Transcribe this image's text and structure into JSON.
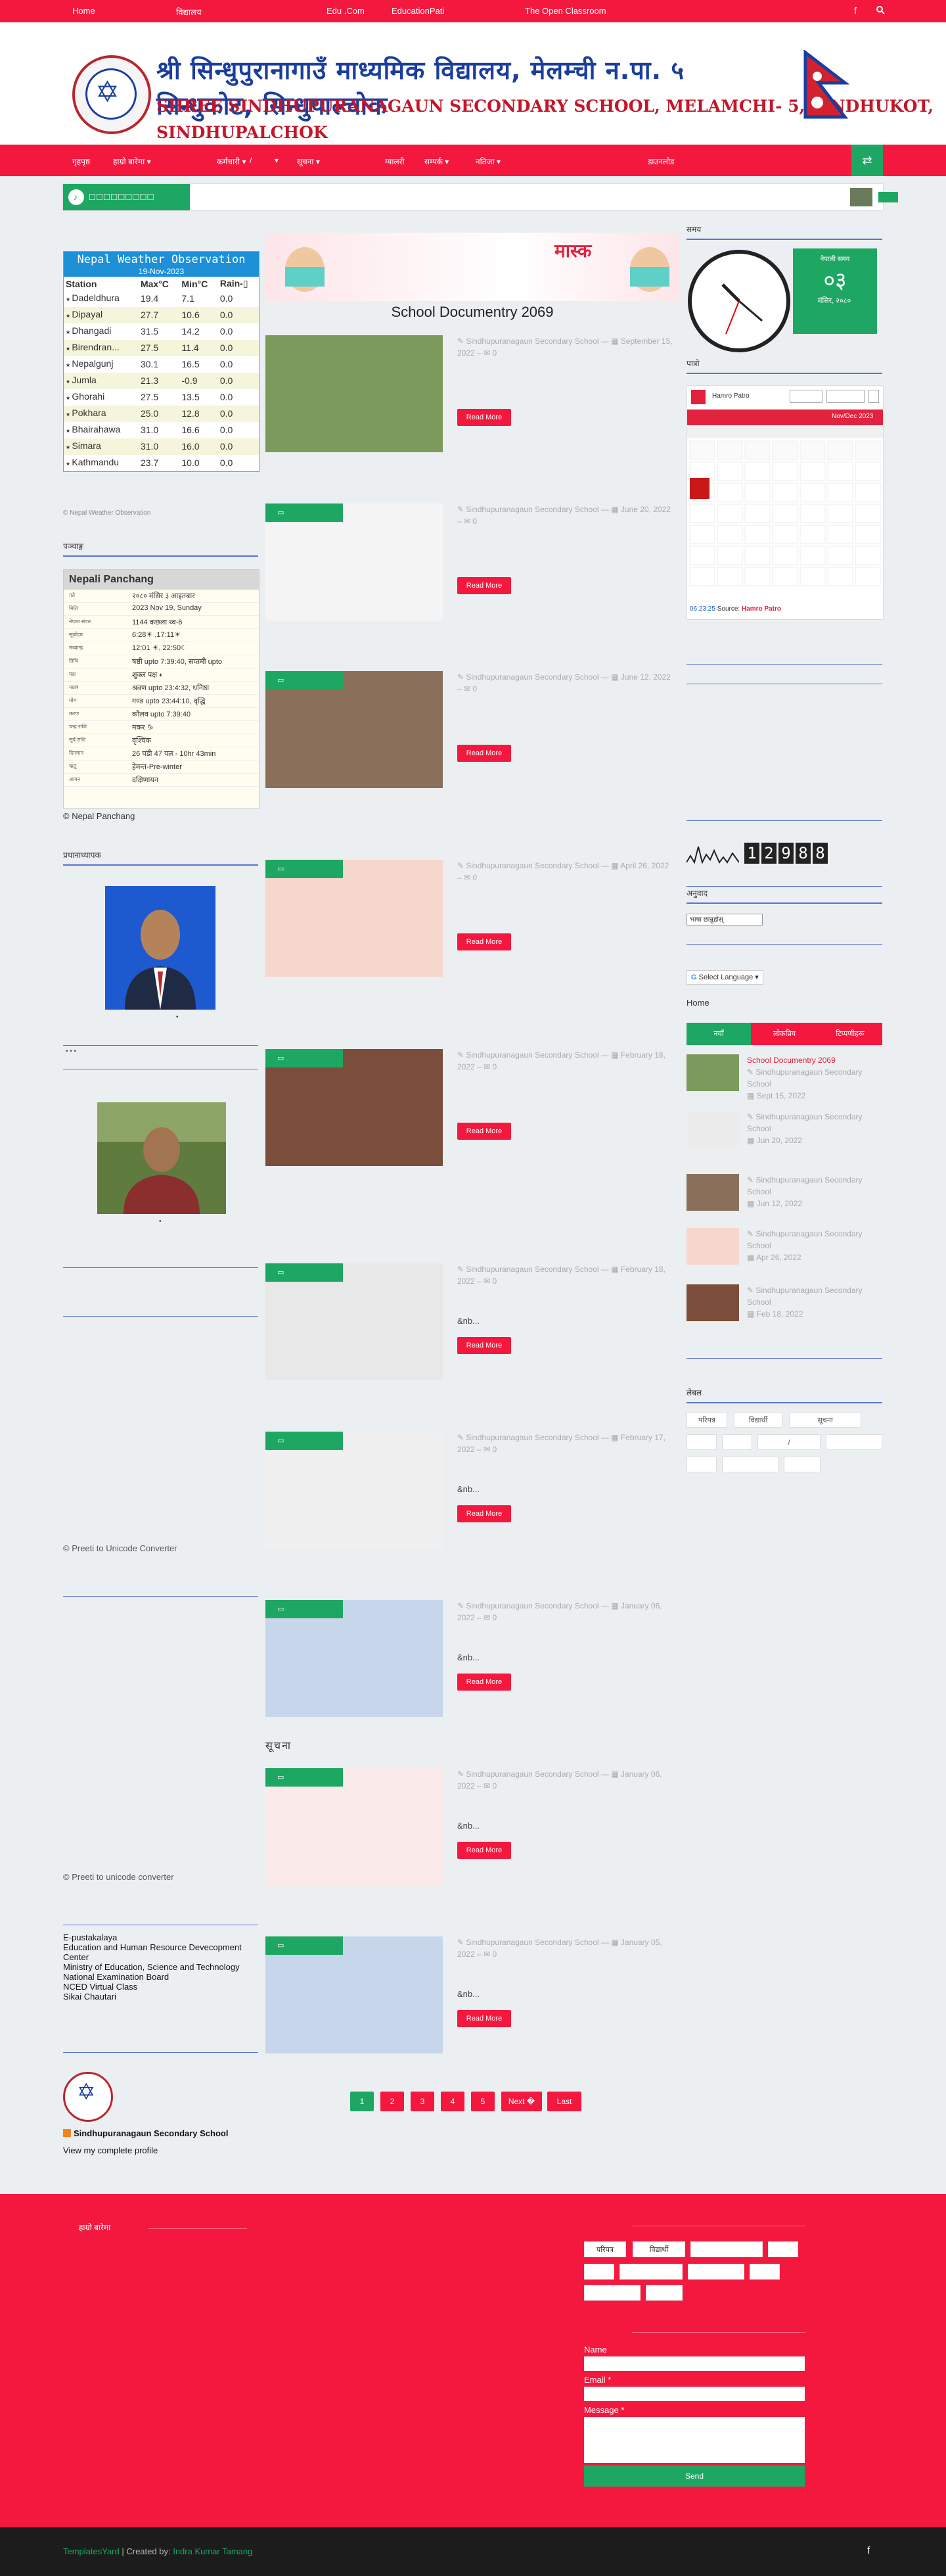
{
  "topbar": {
    "links": [
      "Home",
      "विद्यालय",
      "Edu .Com",
      "EducationPati",
      "The Open Classroom"
    ],
    "facebook_icon": "facebook-icon",
    "search_icon": "search-icon"
  },
  "header": {
    "title_ne": "श्री सिन्धुपुरानागाउँ माध्यमिक विद्यालय, मेलम्ची न.पा. ५ सिन्धुकोट, सिन्धुपाल्चोक",
    "title_en": "SHREE SINDHUPURANAGAUN SECONDARY SCHOOL, MELAMCHI- 5, SINDHUKOT, SINDHUPALCHOK"
  },
  "nav": {
    "items": [
      "गृहपृष्ठ",
      "हाम्रो बारेमा ▾",
      "कर्मचारी ▾",
      "/",
      "▾",
      "सूचना ▾",
      "ग्यालरी",
      "सम्पर्क ▾",
      "नतिजा ▾",
      "डाउनलोड"
    ],
    "shuffle_icon": "shuffle-icon"
  },
  "ticker": {
    "label": "□□□□□□□□□",
    "music_icon": "music-icon"
  },
  "weather": {
    "title": "Nepal Weather Observation",
    "date": "19-Nov-2023",
    "headers": [
      "Station",
      "Max°C",
      "Min°C",
      "Rain-▯"
    ],
    "rows": [
      [
        "Dadeldhura",
        "19.4",
        "7.1",
        "0.0"
      ],
      [
        "Dipayal",
        "27.7",
        "10.6",
        "0.0"
      ],
      [
        "Dhangadi",
        "31.5",
        "14.2",
        "0.0"
      ],
      [
        "Birendran...",
        "27.5",
        "11.4",
        "0.0"
      ],
      [
        "Nepalgunj",
        "30.1",
        "16.5",
        "0.0"
      ],
      [
        "Jumla",
        "21.3",
        "-0.9",
        "0.0"
      ],
      [
        "Ghorahi",
        "27.5",
        "13.5",
        "0.0"
      ],
      [
        "Pokhara",
        "25.0",
        "12.8",
        "0.0"
      ],
      [
        "Bhairahawa",
        "31.0",
        "16.6",
        "0.0"
      ],
      [
        "Simara",
        "31.0",
        "16.0",
        "0.0"
      ],
      [
        "Kathmandu",
        "23.7",
        "10.0",
        "0.0"
      ]
    ],
    "credit": "© Nepal Weather Observation"
  },
  "panchang": {
    "section_title": "पञ्चाङ्ग",
    "title": "Nepali Panchang",
    "rows": [
      [
        "गते",
        "२०८० मंसिर ३ आइतबार"
      ],
      [
        "मिति",
        "2023 Nov 19, Sunday"
      ],
      [
        "नेपाल संवत",
        "1144 कछला थ्व-6"
      ],
      [
        "सूर्योदय",
        "6:28☀ ,17:11☀"
      ],
      [
        "मध्यान्ह",
        "12:01 ☀, 22:50☾"
      ],
      [
        "तिथि",
        "षष्ठी upto 7:39:40, सप्तमी upto"
      ],
      [
        "पक्ष",
        "शुक्ल पक्ष ◐"
      ],
      [
        "नक्षत्र",
        "श्रवण upto 23:4:32, धनिष्ठा"
      ],
      [
        "योग",
        "गण्ड upto 23:44:10, वृद्धि"
      ],
      [
        "करण",
        "कौलव upto 7:39:40"
      ],
      [
        "चन्द्र राशि",
        "मकर ♑"
      ],
      [
        "सूर्य राशि",
        "वृश्चिक"
      ],
      [
        "दिनमान",
        "26 घडी 47 पल - 10hr 43min"
      ],
      [
        "ऋतु",
        "हेमन्त-Pre-winter"
      ],
      [
        "आयन",
        "दक्षिणायन"
      ]
    ],
    "credit": "© Nepal Panchang"
  },
  "people": {
    "title1": "प्रधानाध्यापक",
    "title2": "",
    "caption1": "•",
    "caption2": "•"
  },
  "converters": {
    "c1": "© Preeti to Unicode Converter",
    "c2": "© Preeti to unicode converter"
  },
  "links_widget": {
    "items": [
      "E-pustakalaya",
      "Education and Human Resource Devecopment Center",
      "Ministry of Education, Science and Technology",
      "National Examination Board",
      "NCED Virtual Class",
      "Sikai Chautari"
    ]
  },
  "profile": {
    "name": "Sindhupuranagaun Secondary School",
    "link": "View my complete profile"
  },
  "main": {
    "heading": "School Documentry 2069",
    "banner_text": "मास्क",
    "section_label": "सूचना",
    "read_more": "Read More",
    "posts": [
      {
        "author": "Sindhupuranagaun Secondary School",
        "date": "September 15, 2022",
        "comments": "0",
        "excerpt": ""
      },
      {
        "author": "Sindhupuranagaun Secondary School",
        "date": "June 20, 2022",
        "comments": "0",
        "excerpt": ""
      },
      {
        "author": "Sindhupuranagaun Secondary School",
        "date": "June 12, 2022",
        "comments": "0",
        "excerpt": ""
      },
      {
        "author": "Sindhupuranagaun Secondary School",
        "date": "April 26, 2022",
        "comments": "0",
        "excerpt": ""
      },
      {
        "author": "Sindhupuranagaun Secondary School",
        "date": "February 18, 2022",
        "comments": "0",
        "excerpt": ""
      },
      {
        "author": "Sindhupuranagaun Secondary School",
        "date": "February 18, 2022",
        "comments": "0",
        "excerpt": "&nb..."
      },
      {
        "author": "Sindhupuranagaun Secondary School",
        "date": "February 17, 2022",
        "comments": "0",
        "excerpt": "&nb..."
      },
      {
        "author": "Sindhupuranagaun Secondary School",
        "date": "January 06, 2022",
        "comments": "0",
        "excerpt": "&nb..."
      },
      {
        "author": "Sindhupuranagaun Secondary School",
        "date": "January 06, 2022",
        "comments": "0",
        "excerpt": "&nb..."
      },
      {
        "author": "Sindhupuranagaun Secondary School",
        "date": "January 05, 2022",
        "comments": "0",
        "excerpt": "&nb..."
      }
    ],
    "pagination": [
      "1",
      "2",
      "3",
      "4",
      "5",
      "Next �",
      "Last"
    ]
  },
  "right": {
    "time_title": "समय",
    "clock_label": "नेपाली समय",
    "clock_date": "०३",
    "clock_sub": "मंसिर, २०८०",
    "calendar_title": "पात्रो",
    "calendar_brand": "Hamro Patro",
    "calendar_month": "Nov/Dec 2023",
    "calendar_time": "06:23:25",
    "calendar_source": "Source:",
    "calendar_source_name": "Hamro Patro",
    "counter_digits": [
      "1",
      "2",
      "9",
      "8",
      "8"
    ],
    "translate_title": "अनुवाद",
    "translate_select": "भाषा छान्नुहोस्",
    "select_language": "Select Language",
    "home": "Home",
    "tabs": [
      "नयाँ",
      "लोकप्रिय",
      "टिप्पणीहरू"
    ],
    "recent": [
      {
        "title": "School Documentry 2069",
        "author": "Sindhupuranagaun Secondary School",
        "date": "Sept 15, 2022"
      },
      {
        "title": "",
        "author": "Sindhupuranagaun Secondary School",
        "date": "Jun 20, 2022"
      },
      {
        "title": "",
        "author": "Sindhupuranagaun Secondary School",
        "date": "Jun 12, 2022"
      },
      {
        "title": "",
        "author": "Sindhupuranagaun Secondary School",
        "date": "Apr 26, 2022"
      },
      {
        "title": "",
        "author": "Sindhupuranagaun Secondary School",
        "date": "Feb 18, 2022"
      }
    ],
    "labels_title": "लेबल",
    "labels": [
      "परिपत्र",
      "विद्यार्थी",
      "सूचना",
      "",
      "",
      "/",
      "",
      "",
      "",
      "",
      "",
      ""
    ]
  },
  "footer": {
    "about_title": "हाम्रो बारेमा",
    "labels": [
      "परिपत्र",
      "विद्यार्थी",
      "",
      "",
      "",
      "",
      "",
      "",
      "",
      ""
    ],
    "form": {
      "name": "Name",
      "email": "Email *",
      "message": "Message *",
      "send": "Send"
    }
  },
  "bottombar": {
    "brand": "TemplatesYard",
    "created_by": "| Created by:",
    "author": "Indra Kumar Tamang",
    "facebook_icon": "facebook-icon"
  }
}
